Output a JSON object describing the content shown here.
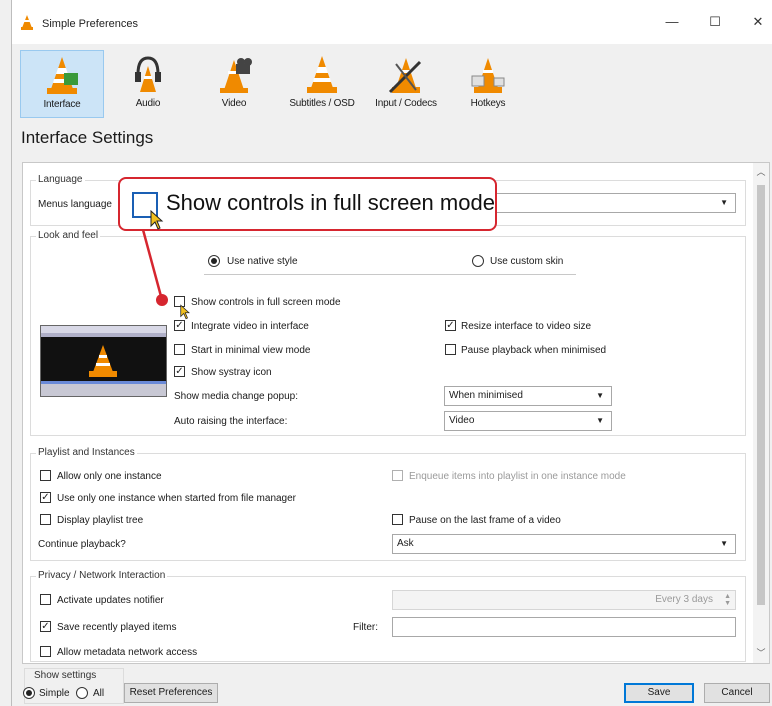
{
  "window": {
    "title": "Simple Preferences",
    "minimize": "—",
    "maximize": "☐",
    "close": "✕"
  },
  "toolbar": [
    {
      "label": "Interface",
      "icon": "interface-cone-icon",
      "active": true
    },
    {
      "label": "Audio",
      "icon": "audio-headphones-icon"
    },
    {
      "label": "Video",
      "icon": "video-cone-icon"
    },
    {
      "label": "Subtitles / OSD",
      "icon": "subtitles-cone-icon"
    },
    {
      "label": "Input / Codecs",
      "icon": "input-cone-icon"
    },
    {
      "label": "Hotkeys",
      "icon": "hotkeys-cone-icon"
    }
  ],
  "heading": "Interface Settings",
  "language": {
    "group": "Language",
    "menus_label": "Menus language"
  },
  "look": {
    "group": "Look and feel",
    "native_style": "Use native style",
    "custom_skin": "Use custom skin",
    "show_controls": "Show controls in full screen mode",
    "integrate_video": "Integrate video in interface",
    "start_minimal": "Start in minimal view mode",
    "systray": "Show systray icon",
    "resize_interface": "Resize interface to video size",
    "pause_minimised": "Pause playback when minimised",
    "media_popup_label": "Show media change popup:",
    "media_popup_value": "When minimised",
    "auto_raise_label": "Auto raising the interface:",
    "auto_raise_value": "Video"
  },
  "playlist": {
    "group": "Playlist and Instances",
    "one_instance": "Allow only one instance",
    "enqueue": "Enqueue items into playlist in one instance mode",
    "file_manager": "Use only one instance when started from file manager",
    "display_tree": "Display playlist tree",
    "pause_last": "Pause on the last frame of a video",
    "continue_label": "Continue playback?",
    "continue_value": "Ask"
  },
  "privacy": {
    "group": "Privacy / Network Interaction",
    "updates": "Activate updates notifier",
    "updates_value": "Every 3 days",
    "recent": "Save recently played items",
    "filter_label": "Filter:",
    "metadata": "Allow metadata network access"
  },
  "footer": {
    "show_settings": "Show settings",
    "simple": "Simple",
    "all": "All",
    "reset": "Reset Preferences",
    "save": "Save",
    "cancel": "Cancel"
  },
  "callout": {
    "text": "Show controls in full screen mode",
    "accent": "#d6262f"
  },
  "colors": {
    "cone_orange": "#f08a00",
    "selection": "#cce4f7"
  }
}
